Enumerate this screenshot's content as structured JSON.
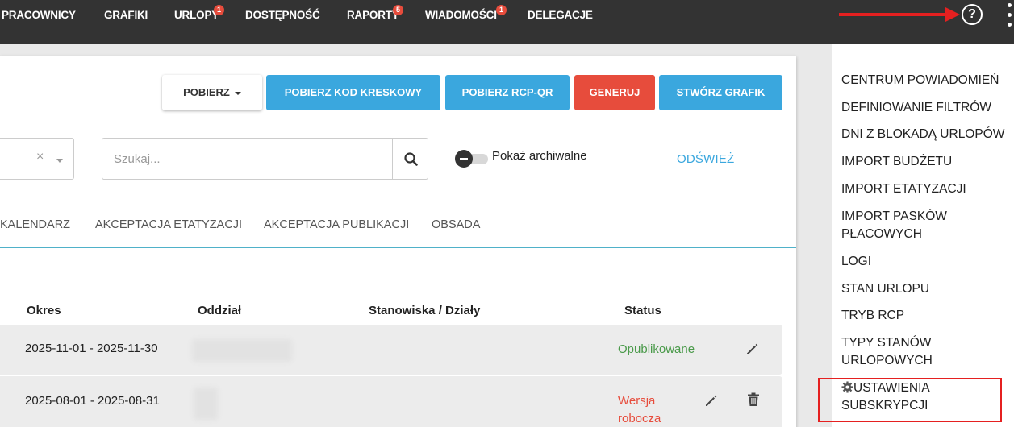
{
  "nav": {
    "items": [
      {
        "label": "PRACOWNICY",
        "badge": null
      },
      {
        "label": "GRAFIKI",
        "badge": null
      },
      {
        "label": "URLOPY",
        "badge": "1"
      },
      {
        "label": "DOSTĘPNOŚĆ",
        "badge": null
      },
      {
        "label": "RAPORTY",
        "badge": "5"
      },
      {
        "label": "WIADOMOŚCI",
        "badge": "1"
      },
      {
        "label": "DELEGACJE",
        "badge": null
      }
    ],
    "help_icon": "?"
  },
  "toolbar": {
    "download_label": "POBIERZ",
    "barcode_label": "POBIERZ KOD KRESKOWY",
    "rcpqr_label": "POBIERZ RCP-QR",
    "generate_label": "GENERUJ",
    "create_label": "STWÓRZ GRAFIK"
  },
  "filters": {
    "select_clear": "×",
    "search_placeholder": "Szukaj...",
    "archive_toggle_label": "Pokaż archiwalne",
    "archive_toggle_on": false,
    "refresh_label": "ODŚWIEŻ"
  },
  "tabs": [
    "KALENDARZ",
    "AKCEPTACJA ETATYZACJI",
    "AKCEPTACJA PUBLIKACJI",
    "OBSADA"
  ],
  "table": {
    "headers": [
      "Okres",
      "Oddział",
      "Stanowiska / Działy",
      "Status"
    ],
    "rows": [
      {
        "period": "2025-11-01 - 2025-11-30",
        "status": "Opublikowane"
      },
      {
        "period": "2025-08-01 - 2025-08-31",
        "status_line1": "Wersja",
        "status_line2": "robocza"
      }
    ]
  },
  "menu": {
    "items": [
      {
        "line1": "CENTRUM POWIADOMIEŃ"
      },
      {
        "line1": "DEFINIOWANIE FILTRÓW"
      },
      {
        "line1": "DNI Z BLOKADĄ URLOPÓW"
      },
      {
        "line1": "IMPORT BUDŻETU"
      },
      {
        "line1": "IMPORT ETATYZACJI"
      },
      {
        "line1": "IMPORT PASKÓW",
        "line2": "PŁACOWYCH"
      },
      {
        "line1": "LOGI"
      },
      {
        "line1": "STAN URLOPU"
      },
      {
        "line1": "TRYB RCP"
      },
      {
        "line1": "TYPY STANÓW",
        "line2": "URLOPOWYCH"
      },
      {
        "line1": "USTAWIENIA",
        "line2": "SUBSKRYPCJI"
      }
    ]
  },
  "colors": {
    "nav_bg": "#333333",
    "accent_blue": "#3aa7de",
    "accent_red": "#e74c3c",
    "status_published": "#4a9a4a",
    "annotation_red": "#e52020"
  }
}
